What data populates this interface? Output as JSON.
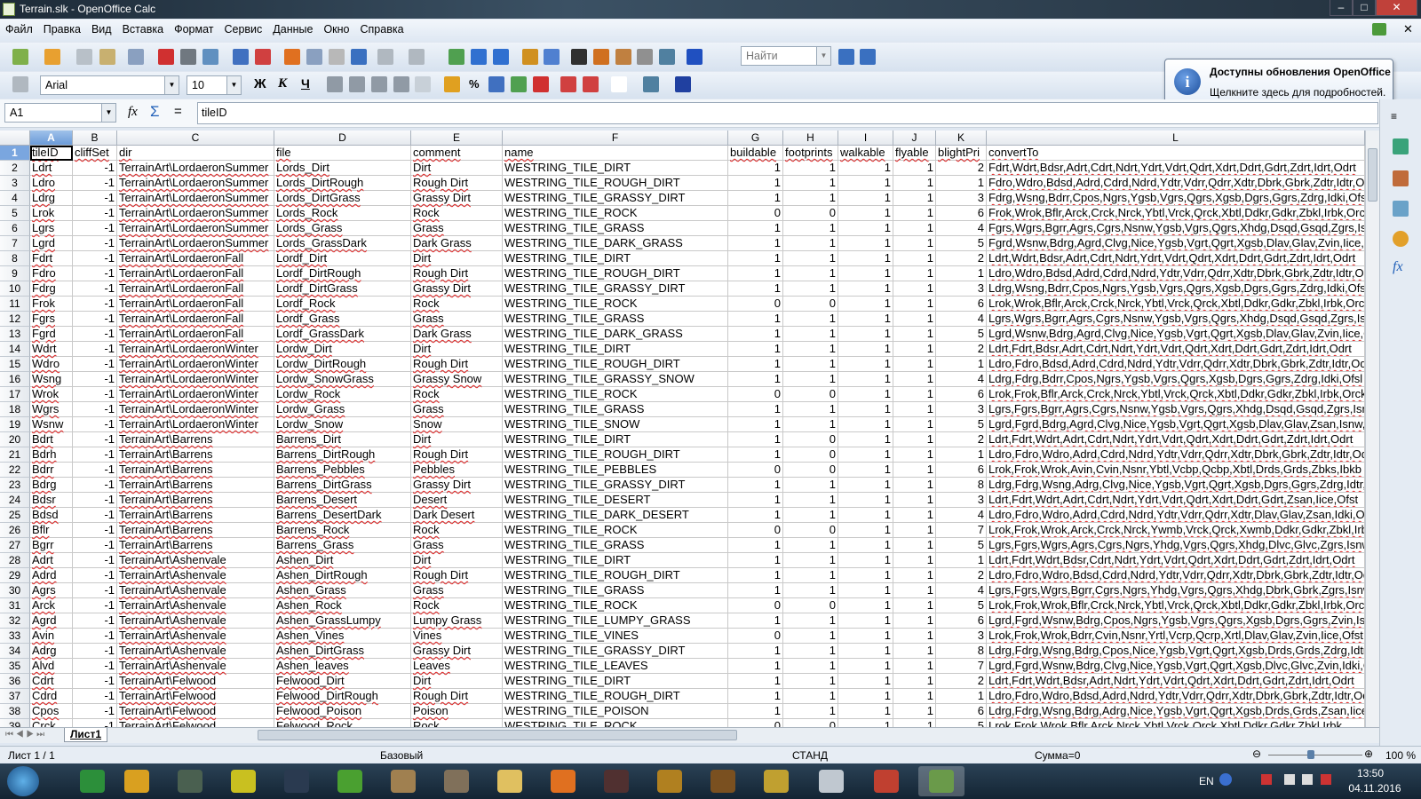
{
  "window": {
    "title": "Terrain.slk - OpenOffice Calc",
    "minimize": "–",
    "maximize": "□",
    "close": "✕"
  },
  "menu": [
    "Файл",
    "Правка",
    "Вид",
    "Вставка",
    "Формат",
    "Сервис",
    "Данные",
    "Окно",
    "Справка"
  ],
  "toolbar": {
    "find_placeholder": "Найти",
    "font_name": "Arial",
    "font_size": "10",
    "bold": "Ж",
    "italic": "К",
    "underline": "Ч",
    "percent": "%"
  },
  "notification": {
    "title": "Доступны обновления OpenOffice",
    "body": "Щелкните здесь для подробностей."
  },
  "formula_bar": {
    "cell_ref": "A1",
    "content": "tileID",
    "fx": "fx",
    "sum": "Σ",
    "equals": "="
  },
  "columns": [
    "A",
    "B",
    "C",
    "D",
    "E",
    "F",
    "G",
    "H",
    "I",
    "J",
    "K",
    "L"
  ],
  "rows": [
    [
      "tileID",
      "cliffSet",
      "dir",
      "file",
      "comment",
      "name",
      "buildable",
      "footprints",
      "walkable",
      "flyable",
      "blightPri",
      "convertTo"
    ],
    [
      "Ldrt",
      "-1",
      "TerrainArt\\LordaeronSummer",
      "Lords_Dirt",
      "Dirt",
      "WESTRING_TILE_DIRT",
      "1",
      "1",
      "1",
      "1",
      "2",
      "Fdrt,Wdrt,Bdsr,Adrt,Cdrt,Ndrt,Ydrt,Vdrt,Qdrt,Xdrt,Ddrt,Gdrt,Zdrt,Idrt,Odrt"
    ],
    [
      "Ldro",
      "-1",
      "TerrainArt\\LordaeronSummer",
      "Lords_DirtRough",
      "Rough Dirt",
      "WESTRING_TILE_ROUGH_DIRT",
      "1",
      "1",
      "1",
      "1",
      "1",
      "Fdro,Wdro,Bdsd,Adrd,Cdrd,Ndrd,Ydtr,Vdrr,Qdrr,Xdtr,Dbrk,Gbrk,Zdtr,Idtr,Odtr"
    ],
    [
      "Ldrg",
      "-1",
      "TerrainArt\\LordaeronSummer",
      "Lords_DirtGrass",
      "Grassy Dirt",
      "WESTRING_TILE_GRASSY_DIRT",
      "1",
      "1",
      "1",
      "1",
      "3",
      "Fdrg,Wsng,Bdrr,Cpos,Ngrs,Ygsb,Vgrs,Qgrs,Xgsb,Dgrs,Ggrs,Zdrg,Idki,Ofsl"
    ],
    [
      "Lrok",
      "-1",
      "TerrainArt\\LordaeronSummer",
      "Lords_Rock",
      "Rock",
      "WESTRING_TILE_ROCK",
      "0",
      "0",
      "1",
      "1",
      "6",
      "Frok,Wrok,Bflr,Arck,Crck,Nrck,Ybtl,Vrck,Qrck,Xbtl,Ddkr,Gdkr,Zbkl,Irbk,Orck"
    ],
    [
      "Lgrs",
      "-1",
      "TerrainArt\\LordaeronSummer",
      "Lords_Grass",
      "Grass",
      "WESTRING_TILE_GRASS",
      "1",
      "1",
      "1",
      "1",
      "4",
      "Fgrs,Wgrs,Bgrr,Agrs,Cgrs,Nsnw,Ygsb,Vgrs,Qgrs,Xhdg,Dsqd,Gsqd,Zgrs,Isnw"
    ],
    [
      "Lgrd",
      "-1",
      "TerrainArt\\LordaeronSummer",
      "Lords_GrassDark",
      "Dark Grass",
      "WESTRING_TILE_DARK_GRASS",
      "1",
      "1",
      "1",
      "1",
      "5",
      "Fgrd,Wsnw,Bdrg,Agrd,Clvg,Nice,Ygsb,Vgrt,Qgrt,Xgsb,Dlav,Glav,Zvin,Iice,Oice"
    ],
    [
      "Fdrt",
      "-1",
      "TerrainArt\\LordaeronFall",
      "Lordf_Dirt",
      "Dirt",
      "WESTRING_TILE_DIRT",
      "1",
      "1",
      "1",
      "1",
      "2",
      "Ldrt,Wdrt,Bdsr,Adrt,Cdrt,Ndrt,Ydrt,Vdrt,Qdrt,Xdrt,Ddrt,Gdrt,Zdrt,Idrt,Odrt"
    ],
    [
      "Fdro",
      "-1",
      "TerrainArt\\LordaeronFall",
      "Lordf_DirtRough",
      "Rough Dirt",
      "WESTRING_TILE_ROUGH_DIRT",
      "1",
      "1",
      "1",
      "1",
      "1",
      "Ldro,Wdro,Bdsd,Adrd,Cdrd,Ndrd,Ydtr,Vdrr,Qdrr,Xdtr,Dbrk,Gbrk,Zdtr,Idtr,Odtr"
    ],
    [
      "Fdrg",
      "-1",
      "TerrainArt\\LordaeronFall",
      "Lordf_DirtGrass",
      "Grassy Dirt",
      "WESTRING_TILE_GRASSY_DIRT",
      "1",
      "1",
      "1",
      "1",
      "3",
      "Ldrg,Wsng,Bdrr,Cpos,Ngrs,Ygsb,Vgrs,Qgrs,Xgsb,Dgrs,Ggrs,Zdrg,Idki,Ofsl"
    ],
    [
      "Frok",
      "-1",
      "TerrainArt\\LordaeronFall",
      "Lordf_Rock",
      "Rock",
      "WESTRING_TILE_ROCK",
      "0",
      "0",
      "1",
      "1",
      "6",
      "Lrok,Wrok,Bflr,Arck,Crck,Nrck,Ybtl,Vrck,Qrck,Xbtl,Ddkr,Gdkr,Zbkl,Irbk,Orck"
    ],
    [
      "Fgrs",
      "-1",
      "TerrainArt\\LordaeronFall",
      "Lordf_Grass",
      "Grass",
      "WESTRING_TILE_GRASS",
      "1",
      "1",
      "1",
      "1",
      "4",
      "Lgrs,Wgrs,Bgrr,Agrs,Cgrs,Nsnw,Ygsb,Vgrs,Qgrs,Xhdg,Dsqd,Gsqd,Zgrs,Isnw"
    ],
    [
      "Fgrd",
      "-1",
      "TerrainArt\\LordaeronFall",
      "Lordf_GrassDark",
      "Dark Grass",
      "WESTRING_TILE_DARK_GRASS",
      "1",
      "1",
      "1",
      "1",
      "5",
      "Lgrd,Wsnw,Bdrg,Agrd,Clvg,Nice,Ygsb,Vgrt,Qgrt,Xgsb,Dlav,Glav,Zvin,Iice,Oice"
    ],
    [
      "Wdrt",
      "-1",
      "TerrainArt\\LordaeronWinter",
      "Lordw_Dirt",
      "Dirt",
      "WESTRING_TILE_DIRT",
      "1",
      "1",
      "1",
      "1",
      "2",
      "Ldrt,Fdrt,Bdsr,Adrt,Cdrt,Ndrt,Ydrt,Vdrt,Qdrt,Xdrt,Ddrt,Gdrt,Zdrt,Idrt,Odrt"
    ],
    [
      "Wdro",
      "-1",
      "TerrainArt\\LordaeronWinter",
      "Lordw_DirtRough",
      "Rough Dirt",
      "WESTRING_TILE_ROUGH_DIRT",
      "1",
      "1",
      "1",
      "1",
      "1",
      "Ldro,Fdro,Bdsd,Adrd,Cdrd,Ndrd,Ydtr,Vdrr,Qdrr,Xdtr,Dbrk,Gbrk,Zdtr,Idtr,Odtr"
    ],
    [
      "Wsng",
      "-1",
      "TerrainArt\\LordaeronWinter",
      "Lordw_SnowGrass",
      "Grassy Snow",
      "WESTRING_TILE_GRASSY_SNOW",
      "1",
      "1",
      "1",
      "1",
      "4",
      "Ldrg,Fdrg,Bdrr,Cpos,Ngrs,Ygsb,Vgrs,Qgrs,Xgsb,Dgrs,Ggrs,Zdrg,Idki,Ofsl"
    ],
    [
      "Wrok",
      "-1",
      "TerrainArt\\LordaeronWinter",
      "Lordw_Rock",
      "Rock",
      "WESTRING_TILE_ROCK",
      "0",
      "0",
      "1",
      "1",
      "6",
      "Lrok,Frok,Bflr,Arck,Crck,Nrck,Ybtl,Vrck,Qrck,Xbtl,Ddkr,Gdkr,Zbkl,Irbk,Orck"
    ],
    [
      "Wgrs",
      "-1",
      "TerrainArt\\LordaeronWinter",
      "Lordw_Grass",
      "Grass",
      "WESTRING_TILE_GRASS",
      "1",
      "1",
      "1",
      "1",
      "3",
      "Lgrs,Fgrs,Bgrr,Agrs,Cgrs,Nsnw,Ygsb,Vgrs,Qgrs,Xhdg,Dsqd,Gsqd,Zgrs,Isnw"
    ],
    [
      "Wsnw",
      "-1",
      "TerrainArt\\LordaeronWinter",
      "Lordw_Snow",
      "Snow",
      "WESTRING_TILE_SNOW",
      "1",
      "1",
      "1",
      "1",
      "5",
      "Lgrd,Fgrd,Bdrg,Agrd,Clvg,Nice,Ygsb,Vgrt,Qgrt,Xgsb,Dlav,Glav,Zsan,Isnw,"
    ],
    [
      "Bdrt",
      "-1",
      "TerrainArt\\Barrens",
      "Barrens_Dirt",
      "Dirt",
      "WESTRING_TILE_DIRT",
      "1",
      "0",
      "1",
      "1",
      "2",
      "Ldrt,Fdrt,Wdrt,Adrt,Cdrt,Ndrt,Ydrt,Vdrt,Qdrt,Xdrt,Ddrt,Gdrt,Zdrt,Idrt,Odrt"
    ],
    [
      "Bdrh",
      "-1",
      "TerrainArt\\Barrens",
      "Barrens_DirtRough",
      "Rough Dirt",
      "WESTRING_TILE_ROUGH_DIRT",
      "1",
      "0",
      "1",
      "1",
      "1",
      "Ldro,Fdro,Wdro,Adrd,Cdrd,Ndrd,Ydtr,Vdrr,Qdrr,Xdtr,Dbrk,Gbrk,Zdtr,Idtr,Odtr"
    ],
    [
      "Bdrr",
      "-1",
      "TerrainArt\\Barrens",
      "Barrens_Pebbles",
      "Pebbles",
      "WESTRING_TILE_PEBBLES",
      "0",
      "0",
      "1",
      "1",
      "6",
      "Lrok,Frok,Wrok,Avin,Cvin,Nsnr,Ybtl,Vcbp,Qcbp,Xbtl,Drds,Grds,Zbks,Ibkb"
    ],
    [
      "Bdrg",
      "-1",
      "TerrainArt\\Barrens",
      "Barrens_DirtGrass",
      "Grassy Dirt",
      "WESTRING_TILE_GRASSY_DIRT",
      "1",
      "1",
      "1",
      "1",
      "8",
      "Ldrg,Fdrg,Wsng,Adrg,Clvg,Nice,Ygsb,Vgrt,Qgrt,Xgsb,Dgrs,Ggrs,Zdrg,Idtr,"
    ],
    [
      "Bdsr",
      "-1",
      "TerrainArt\\Barrens",
      "Barrens_Desert",
      "Desert",
      "WESTRING_TILE_DESERT",
      "1",
      "1",
      "1",
      "1",
      "3",
      "Ldrt,Fdrt,Wdrt,Adrt,Cdrt,Ndrt,Ydrt,Vdrt,Qdrt,Xdrt,Ddrt,Gdrt,Zsan,Iice,Ofst"
    ],
    [
      "Bdsd",
      "-1",
      "TerrainArt\\Barrens",
      "Barrens_DesertDark",
      "Dark Desert",
      "WESTRING_TILE_DARK_DESERT",
      "1",
      "1",
      "1",
      "1",
      "4",
      "Ldro,Fdro,Wdro,Adrd,Cdrd,Ndrd,Ydtr,Vdrr,Qdrr,Xdtr,Dlav,Glav,Zsan,Idki,Odtr"
    ],
    [
      "Bflr",
      "-1",
      "TerrainArt\\Barrens",
      "Barrens_Rock",
      "Rock",
      "WESTRING_TILE_ROCK",
      "0",
      "0",
      "1",
      "1",
      "7",
      "Lrok,Frok,Wrok,Arck,Crck,Nrck,Ywmb,Vrck,Qrck,Xwmb,Ddkr,Gdkr,Zbkl,Irbk"
    ],
    [
      "Bgrr",
      "-1",
      "TerrainArt\\Barrens",
      "Barrens_Grass",
      "Grass",
      "WESTRING_TILE_GRASS",
      "1",
      "1",
      "1",
      "1",
      "5",
      "Lgrs,Fgrs,Wgrs,Agrs,Cgrs,Ngrs,Yhdg,Vgrs,Qgrs,Xhdg,Dlvc,Glvc,Zgrs,Isnw"
    ],
    [
      "Adrt",
      "-1",
      "TerrainArt\\Ashenvale",
      "Ashen_Dirt",
      "Dirt",
      "WESTRING_TILE_DIRT",
      "1",
      "1",
      "1",
      "1",
      "1",
      "Ldrt,Fdrt,Wdrt,Bdsr,Cdrt,Ndrt,Ydrt,Vdrt,Qdrt,Xdrt,Ddrt,Gdrt,Zdrt,Idrt,Odrt"
    ],
    [
      "Adrd",
      "-1",
      "TerrainArt\\Ashenvale",
      "Ashen_DirtRough",
      "Rough Dirt",
      "WESTRING_TILE_ROUGH_DIRT",
      "1",
      "1",
      "1",
      "1",
      "2",
      "Ldro,Fdro,Wdro,Bdsd,Cdrd,Ndrd,Ydtr,Vdrr,Qdrr,Xdtr,Dbrk,Gbrk,Zdtr,Idtr,Odtr"
    ],
    [
      "Agrs",
      "-1",
      "TerrainArt\\Ashenvale",
      "Ashen_Grass",
      "Grass",
      "WESTRING_TILE_GRASS",
      "1",
      "1",
      "1",
      "1",
      "4",
      "Lgrs,Fgrs,Wgrs,Bgrr,Cgrs,Ngrs,Yhdg,Vgrs,Qgrs,Xhdg,Dbrk,Gbrk,Zgrs,Isnw"
    ],
    [
      "Arck",
      "-1",
      "TerrainArt\\Ashenvale",
      "Ashen_Rock",
      "Rock",
      "WESTRING_TILE_ROCK",
      "0",
      "0",
      "1",
      "1",
      "5",
      "Lrok,Frok,Wrok,Bflr,Crck,Nrck,Ybtl,Vrck,Qrck,Xbtl,Ddkr,Gdkr,Zbkl,Irbk,Orck"
    ],
    [
      "Agrd",
      "-1",
      "TerrainArt\\Ashenvale",
      "Ashen_GrassLumpy",
      "Lumpy Grass",
      "WESTRING_TILE_LUMPY_GRASS",
      "1",
      "1",
      "1",
      "1",
      "6",
      "Lgrd,Fgrd,Wsnw,Bdrg,Cpos,Ngrs,Ygsb,Vgrs,Qgrs,Xgsb,Dgrs,Ggrs,Zvin,Isnw"
    ],
    [
      "Avin",
      "-1",
      "TerrainArt\\Ashenvale",
      "Ashen_Vines",
      "Vines",
      "WESTRING_TILE_VINES",
      "0",
      "1",
      "1",
      "1",
      "3",
      "Lrok,Frok,Wrok,Bdrr,Cvin,Nsnr,Yrtl,Vcrp,Qcrp,Xrtl,Dlav,Glav,Zvin,Iice,Ofst"
    ],
    [
      "Adrg",
      "-1",
      "TerrainArt\\Ashenvale",
      "Ashen_DirtGrass",
      "Grassy  Dirt",
      "WESTRING_TILE_GRASSY_DIRT",
      "1",
      "1",
      "1",
      "1",
      "8",
      "Ldrg,Fdrg,Wsng,Bdrg,Cpos,Nice,Ygsb,Vgrt,Qgrt,Xgsb,Drds,Grds,Zdrg,Idtr"
    ],
    [
      "Alvd",
      "-1",
      "TerrainArt\\Ashenvale",
      "Ashen_leaves",
      "Leaves",
      "WESTRING_TILE_LEAVES",
      "1",
      "1",
      "1",
      "1",
      "7",
      "Lgrd,Fgrd,Wsnw,Bdrg,Clvg,Nice,Ygsb,Vgrt,Qgrt,Xgsb,Dlvc,Glvc,Zvin,Idki,Ofsl"
    ],
    [
      "Cdrt",
      "-1",
      "TerrainArt\\Felwood",
      "Felwood_Dirt",
      "Dirt",
      "WESTRING_TILE_DIRT",
      "1",
      "1",
      "1",
      "1",
      "2",
      "Ldrt,Fdrt,Wdrt,Bdsr,Adrt,Ndrt,Ydrt,Vdrt,Qdrt,Xdrt,Ddrt,Gdrt,Zdrt,Idrt,Odrt"
    ],
    [
      "Cdrd",
      "-1",
      "TerrainArt\\Felwood",
      "Felwood_DirtRough",
      "Rough Dirt",
      "WESTRING_TILE_ROUGH_DIRT",
      "1",
      "1",
      "1",
      "1",
      "1",
      "Ldro,Fdro,Wdro,Bdsd,Adrd,Ndrd,Ydtr,Vdrr,Qdrr,Xdtr,Dbrk,Gbrk,Zdtr,Idtr,Odtr"
    ],
    [
      "Cpos",
      "-1",
      "TerrainArt\\Felwood",
      "Felwood_Poison",
      "Poison",
      "WESTRING_TILE_POISON",
      "1",
      "1",
      "1",
      "1",
      "6",
      "Ldrg,Fdrg,Wsng,Bdrg,Adrg,Nice,Ygsb,Vgrt,Qgrt,Xgsb,Drds,Grds,Zsan,Iice"
    ],
    [
      "Crck",
      "-1",
      "TerrainArt\\Felwood",
      "Felwood_Rock",
      "Rock",
      "WESTRING_TILE_ROCK",
      "0",
      "0",
      "1",
      "1",
      "5",
      "Lrok,Frok,Wrok,Bflr,Arck,Nrck,Ybtl,Vrck,Qrck,Xbtl,Ddkr,Gdkr,Zbkl,Irbk"
    ]
  ],
  "sheet_tabs": [
    "Лист1"
  ],
  "status": {
    "sheet": "Лист 1 / 1",
    "style": "Базовый",
    "mode": "СТАНД",
    "sum": "Сумма=0",
    "zoom": "100 %",
    "zoom_level": 100
  },
  "taskbar": {
    "lang": "EN",
    "time": "13:50",
    "date": "04.11.2016"
  },
  "colors": {
    "spell_underline": "#e02020",
    "selected_header": "#7aa6df",
    "taskbar": "#1b3042"
  }
}
